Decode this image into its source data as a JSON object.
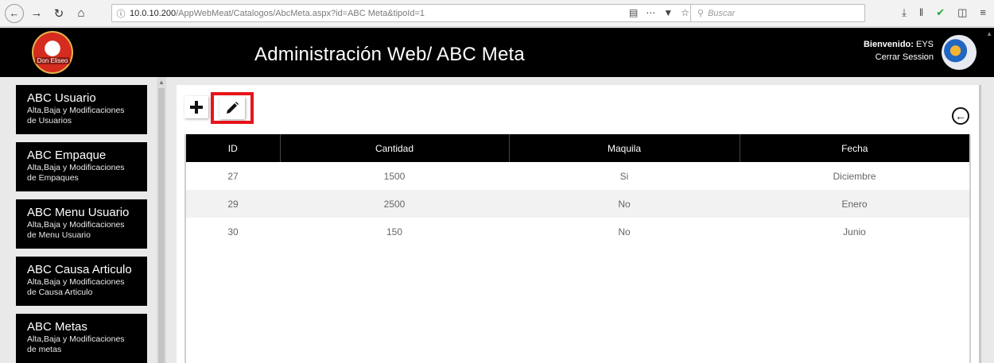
{
  "browser": {
    "url_host": "10.0.10.200",
    "url_path": "/AppWebMeat/Catalogos/AbcMeta.aspx?id=ABC Meta&tipoId=1",
    "search_placeholder": "Buscar"
  },
  "header": {
    "title": "Administración Web/ ABC Meta",
    "welcome_label": "Bienvenido:",
    "user": "EYS",
    "logout": "Cerrar Session",
    "logo_text": "Don Eliseo"
  },
  "sidebar": {
    "items": [
      {
        "title": "ABC Usuario",
        "desc1": "Alta,Baja y Modificaciones",
        "desc2": "de Usuarios"
      },
      {
        "title": "ABC Empaque",
        "desc1": "Alta,Baja y Modificaciones",
        "desc2": "de Empaques"
      },
      {
        "title": "ABC Menu Usuario",
        "desc1": "Alta,Baja y Modificaciones",
        "desc2": "de Menu Usuario"
      },
      {
        "title": "ABC Causa Articulo",
        "desc1": "Alta,Baja y Modificaciones",
        "desc2": "de Causa Articulo"
      },
      {
        "title": "ABC Metas",
        "desc1": "Alta,Baja y Modificaciones",
        "desc2": "de metas"
      }
    ]
  },
  "toolbar": {
    "add_icon": "plus-icon",
    "edit_icon": "pencil-icon",
    "back_icon": "arrow-left-circle-icon",
    "highlight_color": "#e8141b"
  },
  "table": {
    "columns": [
      "ID",
      "Cantidad",
      "Maquila",
      "Fecha"
    ],
    "rows": [
      [
        "27",
        "1500",
        "Si",
        "Diciembre"
      ],
      [
        "29",
        "2500",
        "No",
        "Enero"
      ],
      [
        "30",
        "150",
        "No",
        "Junio"
      ]
    ]
  }
}
